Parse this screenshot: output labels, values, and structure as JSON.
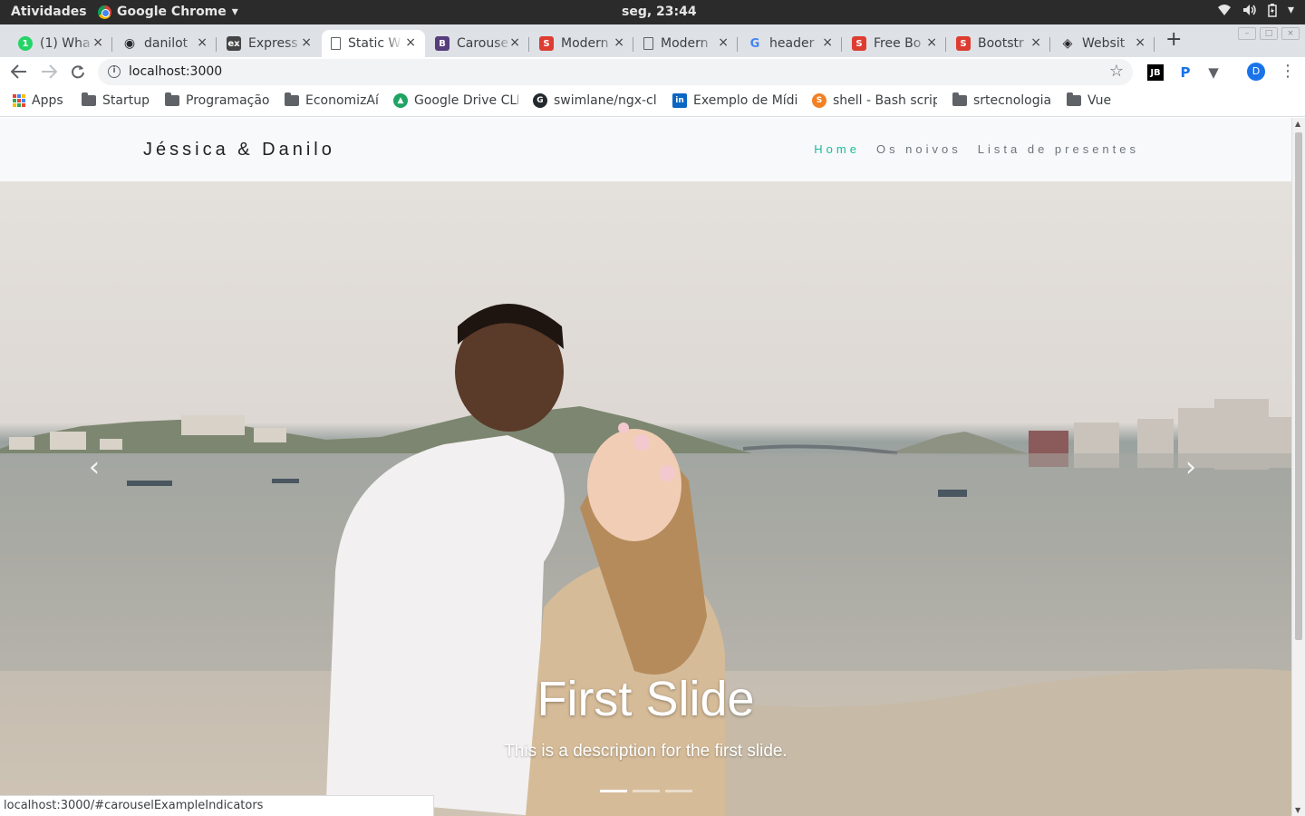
{
  "os": {
    "activities": "Atividades",
    "app_name": "Google Chrome",
    "clock": "seg, 23:44"
  },
  "tabs": [
    {
      "title": "(1) Wha",
      "favicon": "whatsapp-icon",
      "color": "#25d366"
    },
    {
      "title": "danilot",
      "favicon": "github-icon",
      "color": "#24292e"
    },
    {
      "title": "Express",
      "favicon": "express-icon",
      "color": "#444444"
    },
    {
      "title": "Static W",
      "favicon": "page-icon",
      "color": "#5f6368",
      "active": true
    },
    {
      "title": "Carouse",
      "favicon": "bootstrap-icon",
      "color": "#563d7c"
    },
    {
      "title": "Modern",
      "favicon": "startbootstrap-icon",
      "color": "#dd3d31"
    },
    {
      "title": "Modern",
      "favicon": "page-icon",
      "color": "#5f6368"
    },
    {
      "title": "header",
      "favicon": "google-icon",
      "color": "#4285f4"
    },
    {
      "title": "Free Bo",
      "favicon": "startbootstrap-icon",
      "color": "#dd3d31"
    },
    {
      "title": "Bootstr",
      "favicon": "startbootstrap-icon",
      "color": "#dd3d31"
    },
    {
      "title": "Websit",
      "favicon": "codepen-icon",
      "color": "#202124"
    }
  ],
  "toolbar": {
    "url": "localhost:3000"
  },
  "bookmarks": [
    {
      "label": "Apps",
      "icon": "apps-grid-icon"
    },
    {
      "label": "Startup",
      "icon": "folder-icon"
    },
    {
      "label": "Programação",
      "icon": "folder-icon"
    },
    {
      "label": "EconomizAí",
      "icon": "folder-icon"
    },
    {
      "label": "Google Drive CLI",
      "icon": "drive-icon"
    },
    {
      "label": "swimlane/ngx-cl",
      "icon": "github-icon"
    },
    {
      "label": "Exemplo de Mídi",
      "icon": "linkedin-icon"
    },
    {
      "label": "shell - Bash scrip",
      "icon": "stackoverflow-icon"
    },
    {
      "label": "srtecnologia",
      "icon": "folder-icon"
    },
    {
      "label": "Vue",
      "icon": "folder-icon"
    }
  ],
  "site": {
    "brand": "Jéssica & Danilo",
    "nav": [
      {
        "label": "Home",
        "active": true
      },
      {
        "label": "Os noivos",
        "active": false
      },
      {
        "label": "Lista de presentes",
        "active": false
      }
    ],
    "accent_color": "#1abc9c"
  },
  "carousel": {
    "slide_title": "First Slide",
    "slide_description": "This is a description for the first slide.",
    "indicator_count": 3,
    "active_index": 0
  },
  "status_url": "localhost:3000/#carouselExampleIndicators"
}
